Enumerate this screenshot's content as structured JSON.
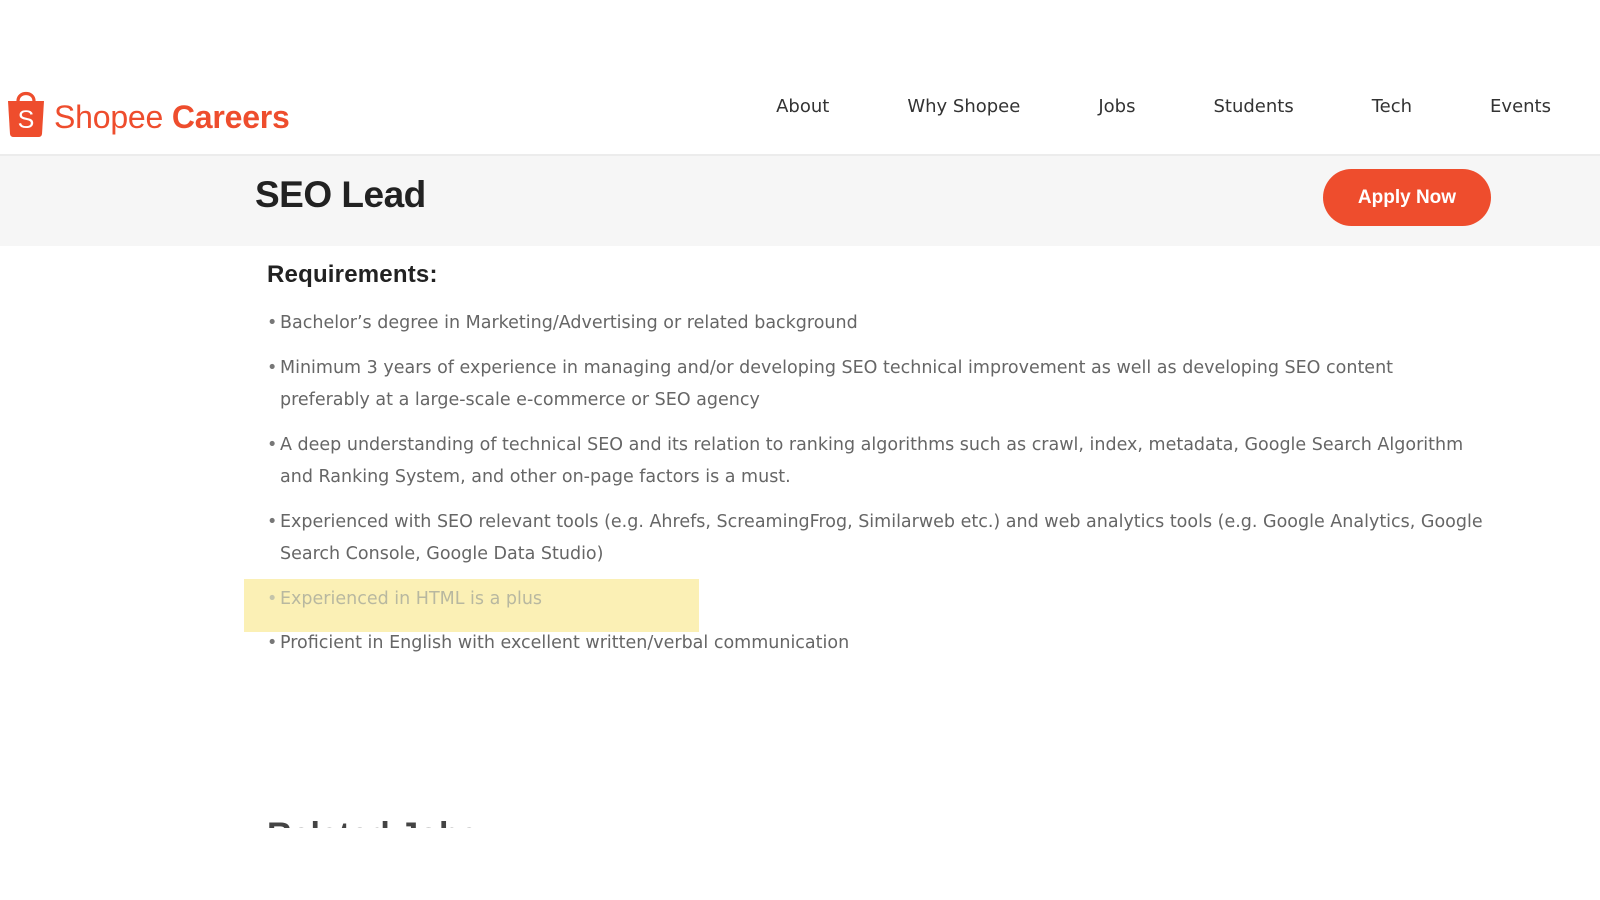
{
  "brand": {
    "name_part1": "Shopee",
    "name_part2": "Careers",
    "bag_letter": "S",
    "color": "#ee4d2d"
  },
  "nav": {
    "items": [
      "About",
      "Why Shopee",
      "Jobs",
      "Students",
      "Tech",
      "Events"
    ]
  },
  "job": {
    "title": "SEO Lead",
    "apply_label": "Apply Now"
  },
  "requirements": {
    "heading": "Requirements:",
    "bullet": "•",
    "items": [
      "Bachelor’s degree in Marketing/Advertising or related background",
      "Minimum 3 years of experience in managing and/or developing SEO technical improvement as well as developing SEO content preferably at a large-scale e-commerce or SEO agency",
      "A deep understanding of technical SEO and its relation to ranking algorithms such as crawl, index, metadata, Google Search Algorithm and Ranking System, and other on-page factors is a must.",
      "Experienced with SEO relevant tools (e.g. Ahrefs, ScreamingFrog, Similarweb etc.) and web analytics tools (e.g. Google Analytics, Google Search Console, Google Data Studio)",
      "Experienced in HTML is a plus",
      "Proficient in English with excellent written/verbal communication"
    ],
    "highlight_color": "#fbf0b5"
  },
  "related": {
    "heading": "Related Jobs"
  }
}
